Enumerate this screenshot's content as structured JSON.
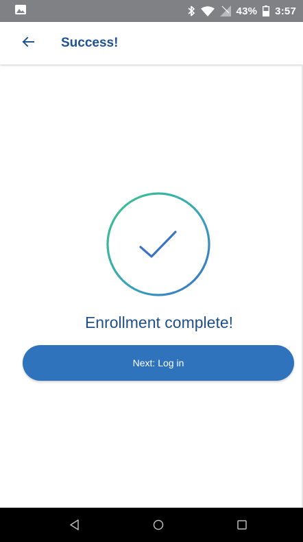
{
  "status_bar": {
    "battery_percent": "43%",
    "time": "3:57",
    "icons": [
      "image-notification-icon",
      "bluetooth-icon",
      "wifi-icon",
      "signal-icon",
      "battery-icon"
    ]
  },
  "app_bar": {
    "title": "Success!",
    "back_icon": "arrow-left-icon"
  },
  "content": {
    "success_icon": "check-circle-icon",
    "message": "Enrollment complete!",
    "next_button_label": "Next: Log in"
  },
  "nav_bar": {
    "icons": [
      "back-triangle-icon",
      "home-circle-icon",
      "recents-square-icon"
    ]
  },
  "colors": {
    "status_bar": "#7f8185",
    "title": "#1f5290",
    "button": "#2f73bd",
    "gradient_start": "#3cc28c",
    "gradient_end": "#3b6fc8"
  }
}
